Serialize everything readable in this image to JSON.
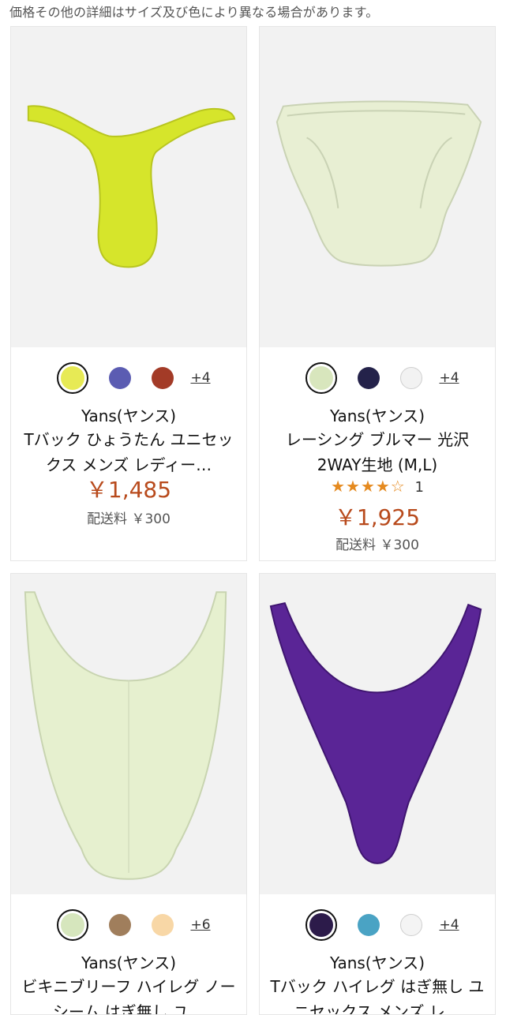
{
  "notice": "価格その他の詳細はサイズ及び色により異なる場合があります。",
  "products": [
    {
      "brand": "Yans(ヤンス)",
      "title": "Tバック ひょうたん ユニセックス メンズ レディー…",
      "price": "￥1,485",
      "shipping": "配送料 ￥300",
      "more_colors": "+4",
      "swatch_colors": [
        "#e7ea55",
        "#5b5cb2",
        "#a33b27"
      ],
      "image_icon": "thong-underwear-icon",
      "image_color": "#d6e52b"
    },
    {
      "brand": "Yans(ヤンス)",
      "title": "レーシング ブルマー 光沢 2WAY生地 (M,L)",
      "rating_stars": "★★★★☆",
      "rating_count": "1",
      "rating_value": 4,
      "price": "￥1,925",
      "shipping": "配送料 ￥300",
      "more_colors": "+4",
      "swatch_colors": [
        "#d8e6bd",
        "#24224a",
        "#f2f2f2"
      ],
      "image_icon": "brief-underwear-icon",
      "image_color": "#e8efd3"
    },
    {
      "brand": "Yans(ヤンス)",
      "title": "ビキニブリーフ ハイレグ ノーシーム はぎ無し ユ…",
      "more_colors": "+6",
      "swatch_colors": [
        "#d6e6bd",
        "#a07e5c",
        "#f8d7a6"
      ],
      "image_icon": "highleg-bikini-icon",
      "image_color": "#e6f0cf"
    },
    {
      "brand": "Yans(ヤンス)",
      "title": "Tバック ハイレグ はぎ無し ユニセックス メンズ レ…",
      "more_colors": "+4",
      "swatch_colors": [
        "#2c1b4a",
        "#4aa3c4",
        "#f4f4f4"
      ],
      "image_icon": "highleg-thong-icon",
      "image_color": "#5a2596"
    }
  ]
}
